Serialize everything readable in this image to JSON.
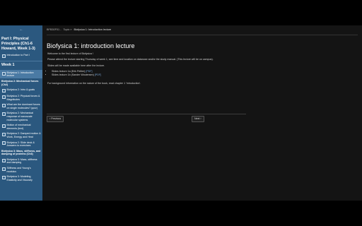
{
  "sidebar": {
    "toggle_icon": "←",
    "part_title": "Part I: Physical Principles (Ch1-6 Howard, Week 1-3)",
    "intro_link": "Introduction to Part I",
    "week_title": "Week 1",
    "items": [
      {
        "type": "item",
        "label": "Biofysica 1: Introduction lecture",
        "active": true
      },
      {
        "type": "group",
        "label": "Biofysica 2: Mechanical forces (Ch2)"
      },
      {
        "type": "item",
        "label": "Biofysica 2: Intro & goals"
      },
      {
        "type": "item",
        "label": "Biofysica 2: Physical forces & Magnitudes"
      },
      {
        "type": "item",
        "label": "What are the dominant forces on single molecules? (quiz)"
      },
      {
        "type": "item",
        "label": "Biofysica 2: Mechanical response of nanoscale molecular systems"
      },
      {
        "type": "item",
        "label": "Motion of mechanical elements (text)"
      },
      {
        "type": "item",
        "label": "Biofysica 2: Damped motion & Work, Energy and Heat"
      },
      {
        "type": "item",
        "label": "Biofysica 2: Slide deck & Answers to exercises"
      },
      {
        "type": "group",
        "label": "Biofysica 3: Mass, stiffness, and damping of proteins (Ch3)"
      },
      {
        "type": "item",
        "label": "Biofysica 3: Mass, stiffness and damping"
      },
      {
        "type": "item",
        "label": "Stiffness and Young's modulus"
      },
      {
        "type": "item",
        "label": "Biofysica 3: Modeling Elasticity and Viscosity"
      }
    ]
  },
  "breadcrumb": {
    "course": "BFB30F01 -",
    "sep1": "Topic »",
    "current": "Biofysica 1: Introduction lecture"
  },
  "page": {
    "title": "Biofysica 1: introduction lecture",
    "p1": "Welcome to the first lecture of Biofysica !",
    "p2": "Please attend the lecture starting Thursday of week 1, see time and location on datanose and/or the study manual. (This lecture will be on campus).",
    "p3": "Slides will be made available here after the lecture.",
    "slides": [
      {
        "label": "Slides lecture 1a (Erik Peltier)",
        "pdf": "[PDF]"
      },
      {
        "label": "Slides lecture 1b (Sander Woutersen)",
        "pdf": "[PDF]"
      }
    ],
    "p4": "For background information on the nature of the book, read chapter 1 'Introduction'."
  },
  "nav": {
    "previous": "‹ Previous",
    "next": "Next ›"
  }
}
